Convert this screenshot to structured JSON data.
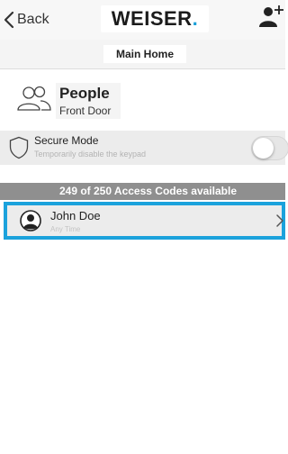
{
  "nav": {
    "back_label": "Back",
    "logo_text": "WEISER",
    "logo_dot": "."
  },
  "home": {
    "name": "Main Home"
  },
  "people": {
    "title": "People",
    "subtitle": "Front Door"
  },
  "secure_mode": {
    "title": "Secure Mode",
    "subtitle": "Temporarily disable the keypad",
    "enabled": false
  },
  "access_codes": {
    "summary": "249 of 250 Access Codes available"
  },
  "users": [
    {
      "name": "John Doe",
      "schedule": "Any Time"
    }
  ],
  "colors": {
    "accent_blue": "#1ba2dc",
    "bar_gray": "#8f8f8f",
    "row_gray": "#ececec"
  }
}
